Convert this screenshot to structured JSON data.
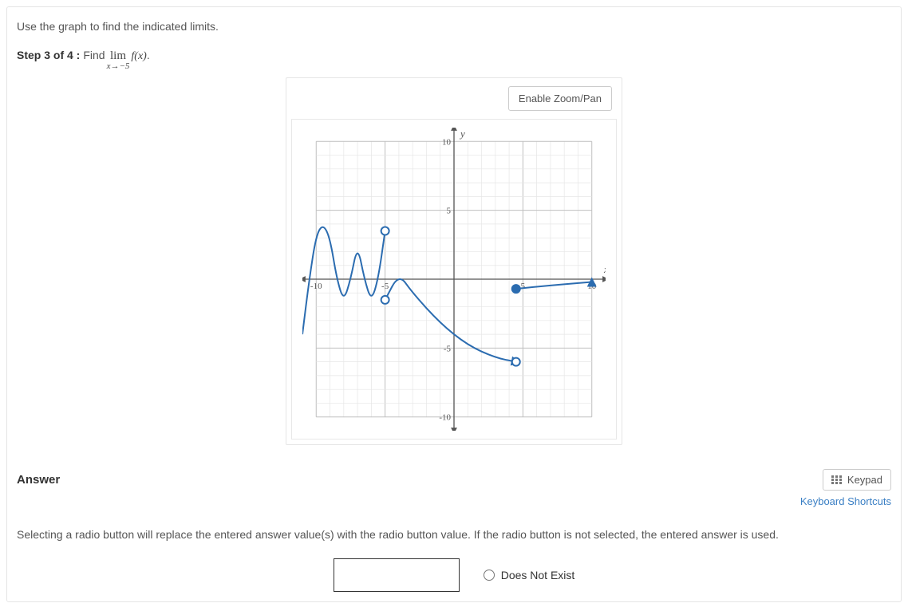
{
  "prompt": "Use the graph to find the indicated limits.",
  "step": {
    "label": "Step 3 of 4 :",
    "find": "Find",
    "limit_top": "lim",
    "limit_bottom": "x→−5",
    "fx": "f(x)",
    "period": "."
  },
  "graph": {
    "zoom_button": "Enable Zoom/Pan",
    "axes": {
      "x_label": "x",
      "y_label": "y",
      "ticks": [
        "-10",
        "-5",
        "5",
        "10"
      ]
    }
  },
  "answer": {
    "title": "Answer",
    "keypad": "Keypad",
    "keyboard_shortcuts": "Keyboard Shortcuts",
    "instructions": "Selecting a radio button will replace the entered answer value(s) with the radio button value. If the radio button is not selected, the entered answer is used.",
    "input_value": "",
    "dne_label": "Does Not Exist"
  },
  "chart_data": {
    "type": "line",
    "xlim": [
      -11,
      11
    ],
    "ylim": [
      -11,
      11
    ],
    "xlabel": "x",
    "ylabel": "y",
    "grid": true,
    "series": [
      {
        "name": "piece1_wave",
        "style": "solid",
        "points": [
          {
            "x": -11,
            "y": -4
          },
          {
            "x": -10.5,
            "y": 0
          },
          {
            "x": -10,
            "y": 3.2
          },
          {
            "x": -9.5,
            "y": 4
          },
          {
            "x": -9,
            "y": 3
          },
          {
            "x": -8.5,
            "y": 0
          },
          {
            "x": -8,
            "y": -1.6
          },
          {
            "x": -7.5,
            "y": 0
          },
          {
            "x": -7,
            "y": 2.5
          },
          {
            "x": -6.5,
            "y": 0
          },
          {
            "x": -6,
            "y": -1.6
          },
          {
            "x": -5.5,
            "y": 0
          },
          {
            "x": -5,
            "y": 3.5
          }
        ],
        "endpoints": [
          {
            "x": -5,
            "y": 3.5,
            "open": true
          }
        ]
      },
      {
        "name": "piece2_curve",
        "style": "solid",
        "points": [
          {
            "x": -5,
            "y": -1.5
          },
          {
            "x": -4,
            "y": 0.4
          },
          {
            "x": -3,
            "y": -1
          },
          {
            "x": -1,
            "y": -3.2
          },
          {
            "x": 1,
            "y": -4.8
          },
          {
            "x": 3,
            "y": -5.7
          },
          {
            "x": 4.5,
            "y": -6
          }
        ],
        "endpoints": [
          {
            "x": -5,
            "y": -1.5,
            "open": true
          },
          {
            "x": 4.5,
            "y": -6,
            "open": true,
            "arrow": true
          }
        ]
      },
      {
        "name": "piece3_tail",
        "style": "solid",
        "points": [
          {
            "x": 4.5,
            "y": -0.7
          },
          {
            "x": 7,
            "y": -0.45
          },
          {
            "x": 10,
            "y": -0.2
          }
        ],
        "endpoints": [
          {
            "x": 4.5,
            "y": -0.7,
            "open": false
          },
          {
            "x": 10,
            "y": -0.2,
            "arrow": true
          }
        ]
      }
    ]
  }
}
